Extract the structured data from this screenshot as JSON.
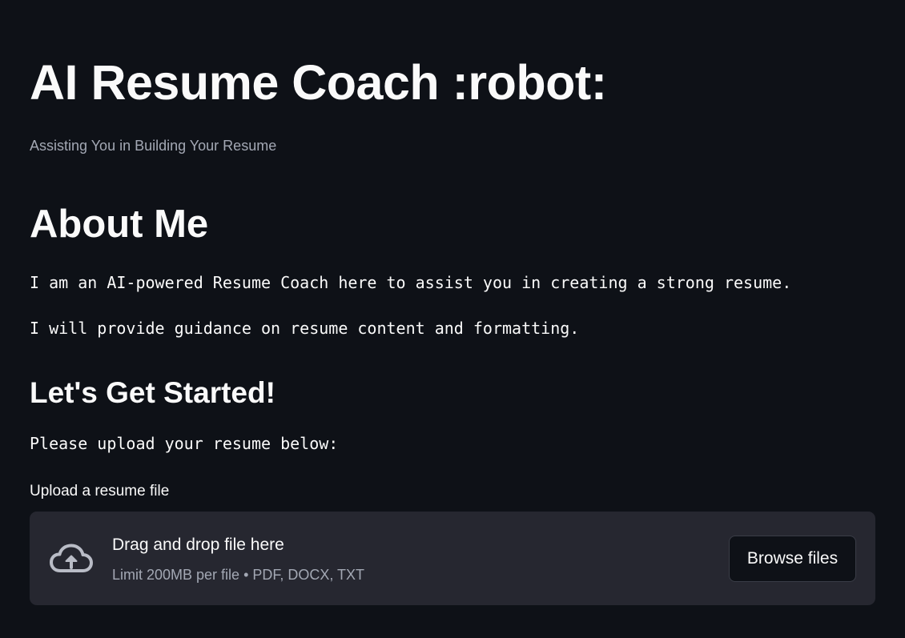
{
  "header": {
    "title": "AI Resume Coach :robot:",
    "subtitle": "Assisting You in Building Your Resume"
  },
  "about": {
    "heading": "About Me",
    "line1": "I am an AI-powered Resume Coach here to assist you in creating a strong resume.",
    "line2": "I will provide guidance on resume content and formatting."
  },
  "start": {
    "heading": "Let's Get Started!",
    "prompt": "Please upload your resume below:"
  },
  "uploader": {
    "label": "Upload a resume file",
    "drop_text": "Drag and drop file here",
    "limit_text": "Limit 200MB per file • PDF, DOCX, TXT",
    "browse_label": "Browse files",
    "icon": "cloud-upload-icon"
  },
  "colors": {
    "background": "#0e1117",
    "dropzone": "#262730",
    "text": "#fafafa",
    "muted": "#a3a8b4"
  }
}
